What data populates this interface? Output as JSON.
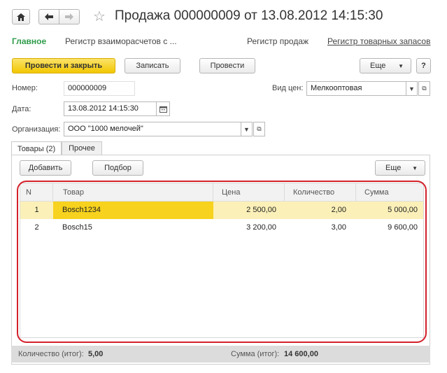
{
  "window": {
    "title": "Продажа 000000009 от 13.08.2012 14:15:30"
  },
  "icons": {
    "home": "home-icon",
    "back": "arrow-left-icon",
    "forward": "arrow-right-icon",
    "favorite": "star-icon"
  },
  "nav": {
    "main": "Главное",
    "mutual": "Регистр взаиморасчетов с ...",
    "sales": "Регистр продаж",
    "stock": "Регистр товарных запасов"
  },
  "toolbar": {
    "post_close": "Провести и закрыть",
    "save": "Записать",
    "post": "Провести",
    "more": "Еще",
    "help": "?"
  },
  "form": {
    "number_label": "Номер:",
    "number_value": "000000009",
    "date_label": "Дата:",
    "date_value": "13.08.2012 14:15:30",
    "org_label": "Организация:",
    "org_value": "ООО \"1000 мелочей\"",
    "price_label": "Вид цен:",
    "price_value": "Мелкооптовая"
  },
  "tabs": {
    "goods": "Товары (2)",
    "other": "Прочее"
  },
  "table_toolbar": {
    "add": "Добавить",
    "pick": "Подбор",
    "more": "Еще"
  },
  "table": {
    "columns": [
      "N",
      "Товар",
      "Цена",
      "Количество",
      "Сумма"
    ],
    "rows": [
      {
        "n": "1",
        "item": "Bosch1234",
        "price": "2 500,00",
        "qty": "2,00",
        "sum": "5 000,00"
      },
      {
        "n": "2",
        "item": "Bosch15",
        "price": "3 200,00",
        "qty": "3,00",
        "sum": "9 600,00"
      }
    ]
  },
  "totals": {
    "qty_label": "Количество (итог):",
    "qty_value": "5,00",
    "sum_label": "Сумма (итог):",
    "sum_value": "14 600,00"
  },
  "colors": {
    "accent_green": "#2e9c4a",
    "primary_button": "#f2c700",
    "selected_row": "#fbf0b8",
    "outline_red": "#d4202a"
  }
}
